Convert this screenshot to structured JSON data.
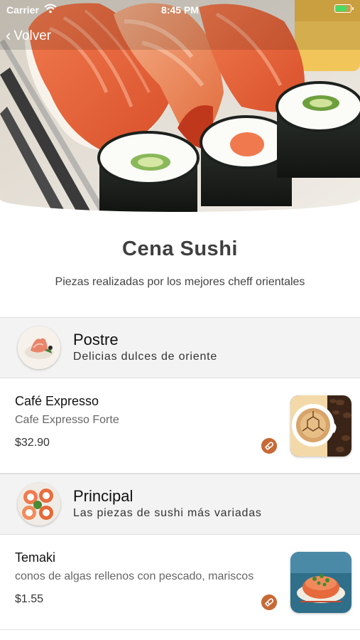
{
  "status_bar": {
    "carrier": "Carrier",
    "time": "8:45 PM"
  },
  "nav": {
    "back_label": "Volver"
  },
  "header": {
    "title": "Cena Sushi",
    "subtitle": "Piezas realizadas por los mejores cheff orientales"
  },
  "sections": [
    {
      "title": "Postre",
      "description": "Delicias dulces de oriente",
      "items": [
        {
          "name": "Café Expresso",
          "description": "Cafe Expresso Forte",
          "price": "$32.90"
        }
      ]
    },
    {
      "title": "Principal",
      "description": "Las piezas de sushi más variadas",
      "items": [
        {
          "name": "Temaki",
          "description": "conos de algas rellenos con pescado, mariscos",
          "price": "$1.55"
        }
      ]
    }
  ],
  "colors": {
    "accent": "#c86a36",
    "section_bg": "#f3f3f3",
    "battery": "#4cd964"
  }
}
